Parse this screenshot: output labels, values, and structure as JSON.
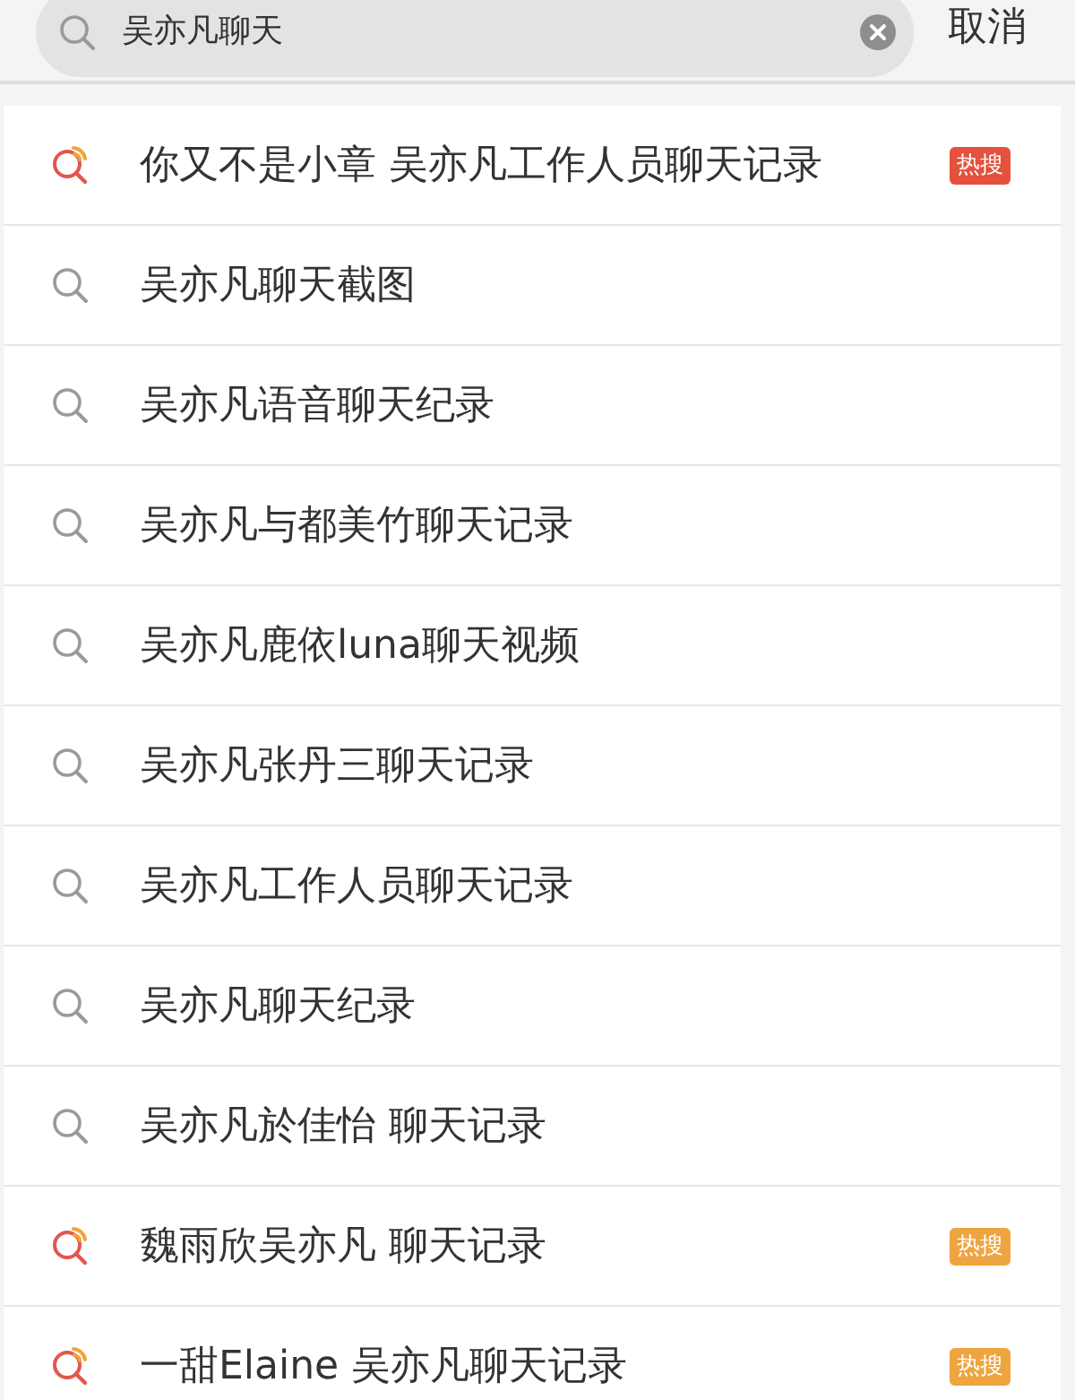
{
  "search": {
    "value": "吴亦凡聊天",
    "cancel": "取消"
  },
  "suggestions": [
    {
      "kind": "hot",
      "text": "你又不是小章 吴亦凡工作人员聊天记录",
      "badge": {
        "label": "热搜",
        "color": "#e4513c"
      }
    },
    {
      "kind": "plain",
      "text": "吴亦凡聊天截图"
    },
    {
      "kind": "plain",
      "text": "吴亦凡语音聊天纪录"
    },
    {
      "kind": "plain",
      "text": "吴亦凡与都美竹聊天记录"
    },
    {
      "kind": "plain",
      "text": "吴亦凡鹿依luna聊天视频"
    },
    {
      "kind": "plain",
      "text": "吴亦凡张丹三聊天记录"
    },
    {
      "kind": "plain",
      "text": "吴亦凡工作人员聊天记录"
    },
    {
      "kind": "plain",
      "text": "吴亦凡聊天纪录"
    },
    {
      "kind": "plain",
      "text": "吴亦凡於佳怡 聊天记录"
    },
    {
      "kind": "hot",
      "text": "魏雨欣吴亦凡 聊天记录",
      "badge": {
        "label": "热搜",
        "color": "#eea43f"
      }
    },
    {
      "kind": "hot",
      "text": "一甜Elaine 吴亦凡聊天记录",
      "badge": {
        "label": "热搜",
        "color": "#eea43f"
      }
    }
  ]
}
